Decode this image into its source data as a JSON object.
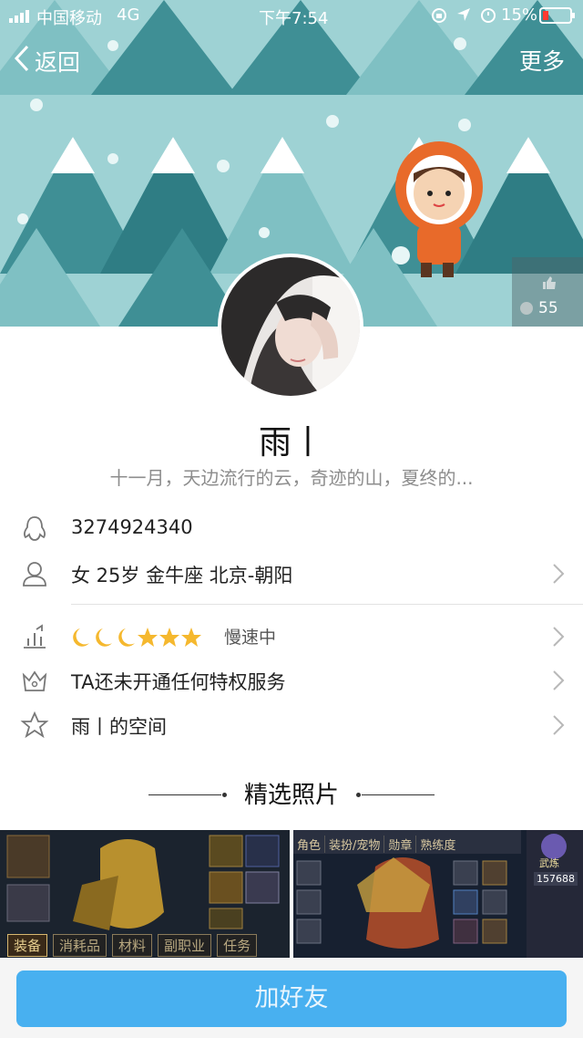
{
  "status_bar": {
    "carrier": "中国移动",
    "network": "4G",
    "time": "下午7:54",
    "battery": "15%"
  },
  "navbar": {
    "back_label": "返回",
    "more_label": "更多"
  },
  "banner": {
    "like_count": "55"
  },
  "profile": {
    "nickname": "雨丨",
    "signature": "十一月，天边流行的云，奇迹的山，夏终的..."
  },
  "info": {
    "qq_number": "3274924340",
    "details": "女  25岁  金牛座  北京-朝阳"
  },
  "level": {
    "status": "慢速中"
  },
  "privilege": {
    "label": "TA还未开通任何特权服务"
  },
  "space": {
    "label": "雨丨的空间"
  },
  "photos_section": {
    "title": "精选照片",
    "photo1_tabs": [
      "装备",
      "消耗品",
      "材料",
      "副职业",
      "任务"
    ],
    "photo2_tabs": [
      "角色",
      "装扮/宠物",
      "勋章",
      "熟练度"
    ],
    "photo2_badge": "武炼",
    "photo2_number": "157688"
  },
  "action": {
    "add_friend_label": "加好友"
  },
  "colors": {
    "banner_sky": "#9ed2d4",
    "tree_dark": "#3f8f95",
    "button_blue": "#48b0f0",
    "secondary_text": "#8d8d8d"
  }
}
